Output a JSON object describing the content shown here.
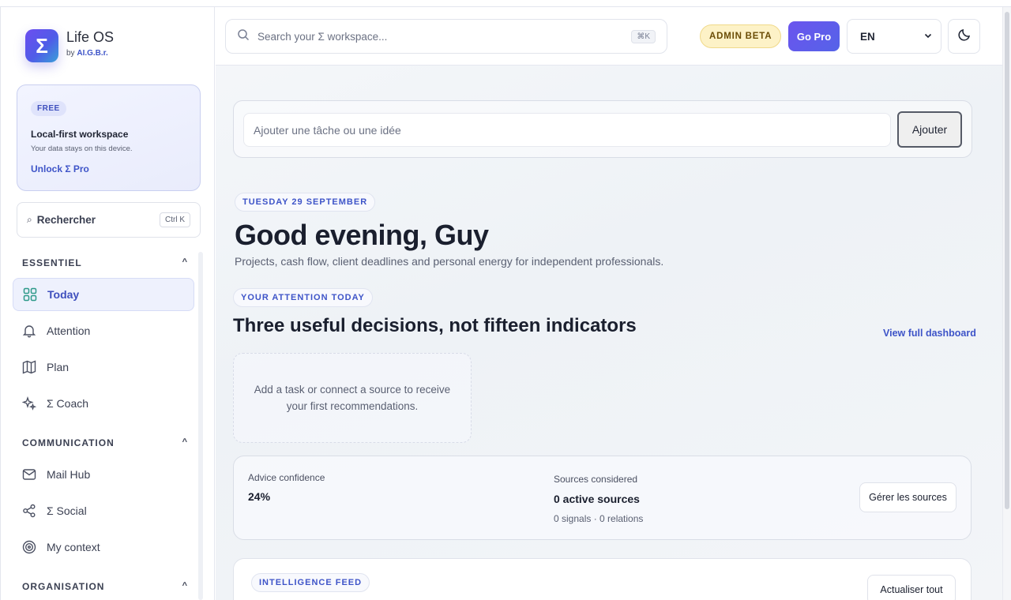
{
  "brand": {
    "name": "Life OS",
    "by_prefix": "by",
    "by_name": "AI.G.B.r.",
    "logo_glyph": "Σ"
  },
  "plan_card": {
    "badge": "FREE",
    "title": "Local-first workspace",
    "subtitle": "Your data stays on this device.",
    "link": "Unlock Σ Pro"
  },
  "sidebar_search": {
    "label": "Rechercher",
    "shortcut": "Ctrl K"
  },
  "sections": [
    {
      "title": "ESSENTIEL",
      "caret": "^",
      "items": [
        {
          "label": "Today",
          "icon": "grid-icon",
          "active": true
        },
        {
          "label": "Attention",
          "icon": "bell-icon",
          "active": false
        },
        {
          "label": "Plan",
          "icon": "map-icon",
          "active": false
        },
        {
          "label": "Σ Coach",
          "icon": "sparkles-icon",
          "active": false
        }
      ]
    },
    {
      "title": "COMMUNICATION",
      "caret": "^",
      "items": [
        {
          "label": "Mail Hub",
          "icon": "mail-icon",
          "active": false
        },
        {
          "label": "Σ Social",
          "icon": "share-icon",
          "active": false
        },
        {
          "label": "My context",
          "icon": "target-icon",
          "active": false
        }
      ]
    },
    {
      "title": "ORGANISATION",
      "caret": "^",
      "items": []
    }
  ],
  "topbar": {
    "search_placeholder": "Search your Σ workspace...",
    "search_shortcut": "⌘K",
    "admin_badge": "ADMIN BETA",
    "go_pro": "Go Pro",
    "language": "EN"
  },
  "quick_add": {
    "placeholder": "Ajouter une tâche ou une idée",
    "button": "Ajouter"
  },
  "hero": {
    "date_pill": "TUESDAY 29 SEPTEMBER",
    "greeting": "Good evening, Guy",
    "subtitle": "Projects, cash flow, client deadlines and personal energy for independent professionals."
  },
  "attention": {
    "pill": "YOUR ATTENTION TODAY",
    "title": "Three useful decisions, not fifteen indicators",
    "link": "View full dashboard",
    "empty": "Add a task or connect a source to receive your first recommendations."
  },
  "metrics": {
    "confidence_label": "Advice confidence",
    "confidence_value": "24%",
    "sources_label": "Sources considered",
    "sources_value": "0 active sources",
    "sources_detail": "0 signals · 0 relations",
    "manage_button": "Gérer les sources"
  },
  "feed": {
    "pill": "INTELLIGENCE FEED",
    "refresh_button": "Actualiser tout"
  },
  "colors": {
    "accent": "#3e54c8",
    "brand_gradient_start": "#6d4ef0",
    "brand_gradient_end": "#3aa0d8",
    "admin_badge_bg": "#fdf2c7",
    "go_pro_bg": "#6b54ee"
  }
}
